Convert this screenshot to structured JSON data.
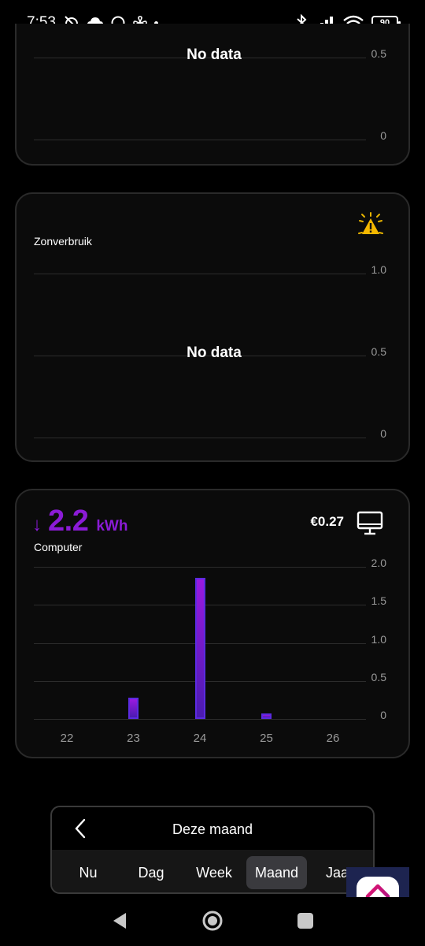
{
  "status_bar": {
    "time": "7:53",
    "battery": "90"
  },
  "card_top": {
    "no_data": "No data",
    "y_ticks": [
      "0.5",
      "0"
    ]
  },
  "card_solar": {
    "title": "Zonverbruik",
    "icon": "sun-warning-icon",
    "no_data": "No data",
    "y_ticks": [
      "1.0",
      "0.5",
      "0"
    ]
  },
  "card_computer": {
    "arrow": "↓",
    "value": "2.2",
    "unit": "kWh",
    "label": "Computer",
    "price": "€0.27",
    "icon": "monitor-icon",
    "accent_color": "#8b1bd6",
    "y_ticks": [
      "2.0",
      "1.5",
      "1.0",
      "0.5",
      "0"
    ],
    "chart_data": {
      "type": "bar",
      "categories": [
        "22",
        "23",
        "24",
        "25",
        "26"
      ],
      "values": [
        0,
        0.28,
        1.85,
        0.07,
        0
      ],
      "ylim": [
        0,
        2.0
      ]
    }
  },
  "period_selector": {
    "title": "Deze maand",
    "tabs": [
      "Nu",
      "Dag",
      "Week",
      "Maand",
      "Jaar"
    ],
    "selected": "Maand"
  },
  "app_badge": {
    "icon": "home-app-icon"
  }
}
